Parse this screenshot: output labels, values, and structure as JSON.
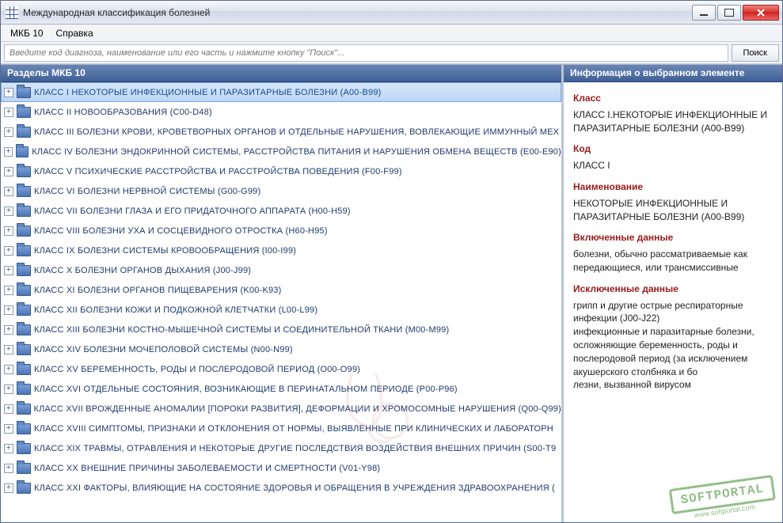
{
  "window": {
    "title": "Международная классификация болезней"
  },
  "menu": {
    "items": [
      "МКБ 10",
      "Справка"
    ]
  },
  "search": {
    "placeholder": "Введите код диагноза, наименование или его часть и нажмите кнопку \"Поиск\"...",
    "button": "Поиск"
  },
  "left": {
    "header": "Разделы МКБ 10",
    "items": [
      {
        "label": "КЛАСС I НЕКОТОРЫЕ ИНФЕКЦИОННЫЕ И ПАРАЗИТАРНЫЕ БОЛЕЗНИ (A00-B99)",
        "selected": true
      },
      {
        "label": "КЛАСС II НОВООБРАЗОВАНИЯ (C00-D48)"
      },
      {
        "label": "КЛАСС III БОЛЕЗНИ КРОВИ, КРОВЕТВОРНЫХ ОРГАНОВ И ОТДЕЛЬНЫЕ НАРУШЕНИЯ, ВОВЛЕКАЮЩИЕ ИММУННЫЙ МЕХ"
      },
      {
        "label": "КЛАСС IV БОЛЕЗНИ ЭНДОКРИННОЙ СИСТЕМЫ, РАССТРОЙСТВА ПИТАНИЯ И НАРУШЕНИЯ ОБМЕНА ВЕЩЕСТВ (E00-E90)"
      },
      {
        "label": "КЛАСС V ПСИХИЧЕСКИЕ РАССТРОЙСТВА И РАССТРОЙСТВА ПОВЕДЕНИЯ (F00-F99)"
      },
      {
        "label": "КЛАСС VI БОЛЕЗНИ НЕРВНОЙ СИСТЕМЫ (G00-G99)"
      },
      {
        "label": "КЛАСС VII БОЛЕЗНИ ГЛАЗА И ЕГО ПРИДАТОЧНОГО АППАРАТА (H00-H59)"
      },
      {
        "label": "КЛАСС VIII БОЛЕЗНИ УХА И СОСЦЕВИДНОГО ОТРОСТКА (H60-H95)"
      },
      {
        "label": "КЛАСС IX БОЛЕЗНИ СИСТЕМЫ КРОВООБРАЩЕНИЯ (I00-I99)"
      },
      {
        "label": "КЛАСС X БОЛЕЗНИ ОРГАНОВ ДЫХАНИЯ (J00-J99)"
      },
      {
        "label": "КЛАСС XI БОЛЕЗНИ ОРГАНОВ ПИЩЕВАРЕНИЯ (K00-K93)"
      },
      {
        "label": "КЛАСС XII БОЛЕЗНИ КОЖИ И ПОДКОЖНОЙ КЛЕТЧАТКИ (L00-L99)"
      },
      {
        "label": "КЛАСС XIII БОЛЕЗНИ КОСТНО-МЫШЕЧНОЙ СИСТЕМЫ И СОЕДИНИТЕЛЬНОЙ ТКАНИ (M00-M99)"
      },
      {
        "label": "КЛАСС XIV БОЛЕЗНИ МОЧЕПОЛОВОЙ СИСТЕМЫ (N00-N99)"
      },
      {
        "label": "КЛАСС XV БЕРЕМЕННОСТЬ, РОДЫ И ПОСЛЕРОДОВОЙ ПЕРИОД (O00-O99)"
      },
      {
        "label": "КЛАСС XVI ОТДЕЛЬНЫЕ СОСТОЯНИЯ, ВОЗНИКАЮЩИЕ В ПЕРИНАТАЛЬНОМ ПЕРИОДЕ (P00-P96)"
      },
      {
        "label": "КЛАСС XVII ВРОЖДЕННЫЕ АНОМАЛИИ [ПОРОКИ РАЗВИТИЯ], ДЕФОРМАЦИИ И ХРОМОСОМНЫЕ НАРУШЕНИЯ (Q00-Q99)"
      },
      {
        "label": "КЛАСС XVIII СИМПТОМЫ, ПРИЗНАКИ И ОТКЛОНЕНИЯ ОТ НОРМЫ, ВЫЯВЛЕННЫЕ ПРИ КЛИНИЧЕСКИХ И ЛАБОРАТОРН"
      },
      {
        "label": "КЛАСС XIX ТРАВМЫ, ОТРАВЛЕНИЯ И НЕКОТОРЫЕ ДРУГИЕ ПОСЛЕДСТВИЯ ВОЗДЕЙСТВИЯ ВНЕШНИХ ПРИЧИН (S00-T9"
      },
      {
        "label": "КЛАСС XX ВНЕШНИЕ ПРИЧИНЫ ЗАБОЛЕВАЕМОСТИ И СМЕРТНОСТИ (V01-Y98)"
      },
      {
        "label": "КЛАСС XXI ФАКТОРЫ, ВЛИЯЮЩИЕ НА СОСТОЯНИЕ ЗДОРОВЬЯ И ОБРАЩЕНИЯ В УЧРЕЖДЕНИЯ ЗДРАВООХРАНЕНИЯ ("
      }
    ]
  },
  "right": {
    "header": "Информация о выбранном элементе",
    "sections": {
      "class_label": "Класс",
      "class_value": "КЛАСС I.НЕКОТОРЫЕ ИНФЕКЦИОННЫЕ И ПАРАЗИТАРНЫЕ БОЛЕЗНИ (A00-B99)",
      "code_label": "Код",
      "code_value": "КЛАСС I",
      "name_label": "Наименование",
      "name_value": "НЕКОТОРЫЕ ИНФЕКЦИОННЫЕ И ПАРАЗИТАРНЫЕ БОЛЕЗНИ (A00-B99)",
      "included_label": "Включенные данные",
      "included_value": "болезни, обычно рассматриваемые как передающиеся, или трансмиссивные",
      "excluded_label": "Исключенные данные",
      "excluded_value": "грипп и другие острые респираторные инфекции (J00-J22)\nинфекционные и паразитарные болезни, осложняющие беременность, роды и послеродовой период (за исключением акушерского столбняка и бо\nлезни, вызванной вирусом"
    }
  },
  "stamp": {
    "main": "SOFTPORTAL",
    "sub": "www.softportal.com"
  }
}
